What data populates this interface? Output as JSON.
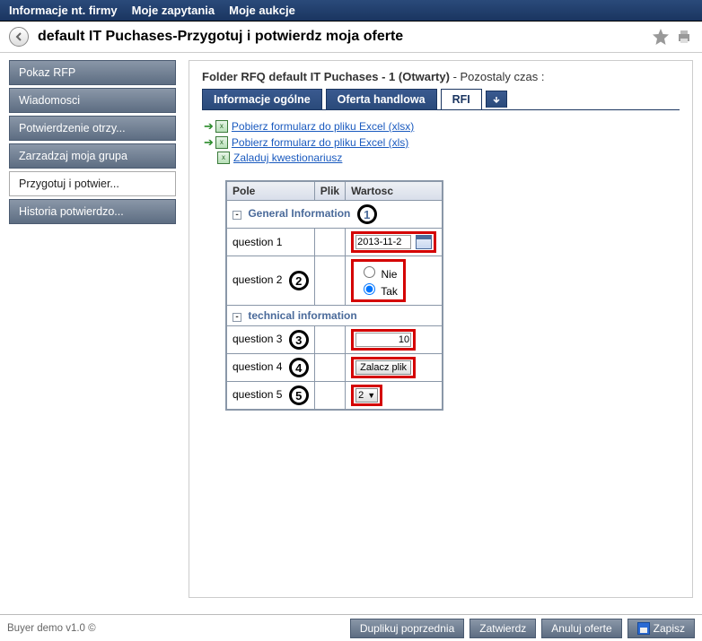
{
  "topnav": {
    "items": [
      "Informacje nt. firmy",
      "Moje zapytania",
      "Moje aukcje"
    ]
  },
  "titlebar": {
    "title": "default IT Puchases-Przygotuj i potwierdz moja oferte"
  },
  "sidebar": {
    "items": [
      {
        "label": "Pokaz RFP"
      },
      {
        "label": "Wiadomosci"
      },
      {
        "label": "Potwierdzenie otrzy..."
      },
      {
        "label": "Zarzadzaj moja grupa"
      },
      {
        "label": "Przygotuj i potwier..."
      },
      {
        "label": "Historia potwierdzo..."
      }
    ],
    "activeIndex": 4
  },
  "folder": {
    "prefix": "Folder RFQ default IT Puchases - 1 (Otwarty)",
    "suffix": " - Pozostaly czas :"
  },
  "tabs": {
    "items": [
      "Informacje ogólne",
      "Oferta handlowa",
      "RFI"
    ],
    "activeIndex": 2
  },
  "links": {
    "xlsx": "Pobierz formularz do pliku Excel (xlsx)",
    "xls": "Pobierz formularz do pliku Excel (xls)",
    "upload": "Zaladuj kwestionariusz"
  },
  "table": {
    "headers": {
      "pole": "Pole",
      "plik": "Plik",
      "wartosc": "Wartosc"
    },
    "section1": "General Information",
    "section2": "technical information",
    "q1": {
      "label": "question 1",
      "value": "2013-11-2",
      "marker": "1"
    },
    "q2": {
      "label": "question 2",
      "opt_no": "Nie",
      "opt_yes": "Tak",
      "marker": "2"
    },
    "q3": {
      "label": "question 3",
      "value": "10",
      "marker": "3"
    },
    "q4": {
      "label": "question 4",
      "btn": "Zalacz plik",
      "marker": "4"
    },
    "q5": {
      "label": "question 5",
      "value": "2",
      "marker": "5"
    }
  },
  "footer": {
    "version": "Buyer demo v1.0  ©",
    "buttons": {
      "dup": "Duplikuj poprzednia",
      "confirm": "Zatwierdz",
      "cancel": "Anuluj oferte",
      "save": "Zapisz"
    }
  }
}
